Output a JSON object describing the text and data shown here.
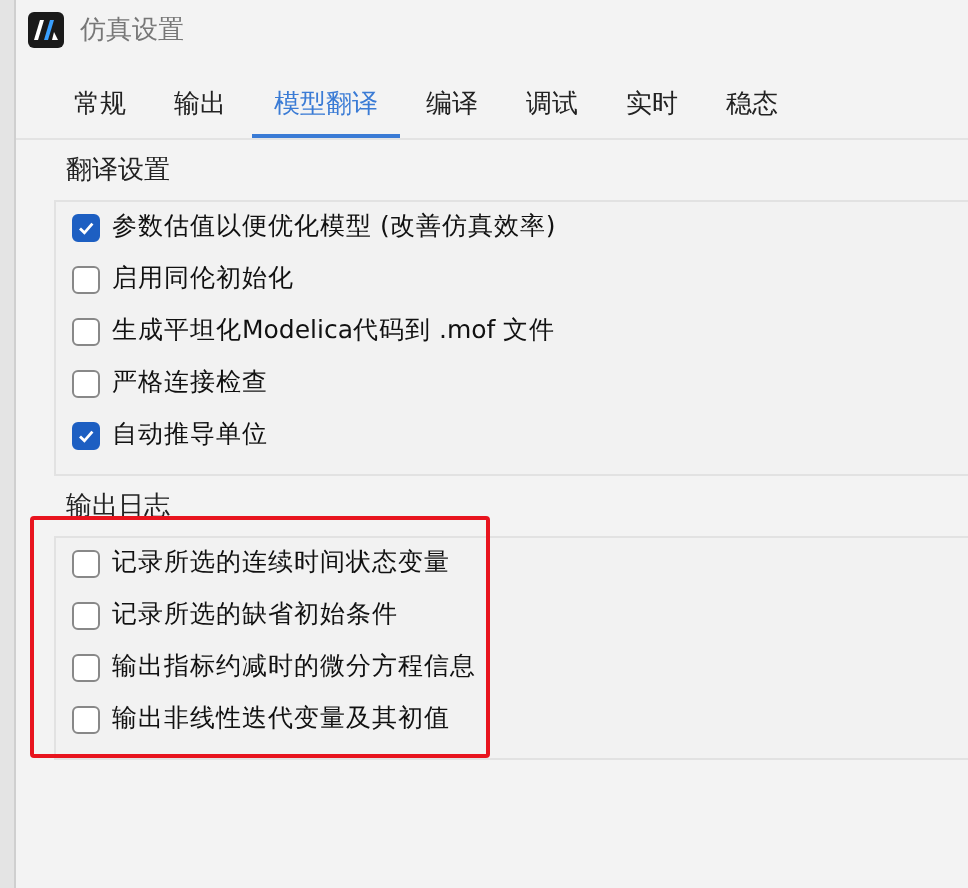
{
  "window": {
    "title": "仿真设置"
  },
  "tabs": [
    {
      "label": "常规",
      "selected": false
    },
    {
      "label": "输出",
      "selected": false
    },
    {
      "label": "模型翻译",
      "selected": true
    },
    {
      "label": "编译",
      "selected": false
    },
    {
      "label": "调试",
      "selected": false
    },
    {
      "label": "实时",
      "selected": false
    },
    {
      "label": "稳态",
      "selected": false
    }
  ],
  "groups": [
    {
      "title": "翻译设置",
      "highlighted": false,
      "options": [
        {
          "label": "参数估值以便优化模型 (改善仿真效率)",
          "checked": true
        },
        {
          "label": "启用同伦初始化",
          "checked": false
        },
        {
          "label": "生成平坦化Modelica代码到 .mof 文件",
          "checked": false
        },
        {
          "label": "严格连接检查",
          "checked": false
        },
        {
          "label": "自动推导单位",
          "checked": true
        }
      ]
    },
    {
      "title": "输出日志",
      "highlighted": true,
      "options": [
        {
          "label": "记录所选的连续时间状态变量",
          "checked": false
        },
        {
          "label": "记录所选的缺省初始条件",
          "checked": false
        },
        {
          "label": "输出指标约减时的微分方程信息",
          "checked": false
        },
        {
          "label": "输出非线性迭代变量及其初值",
          "checked": false
        }
      ]
    }
  ]
}
